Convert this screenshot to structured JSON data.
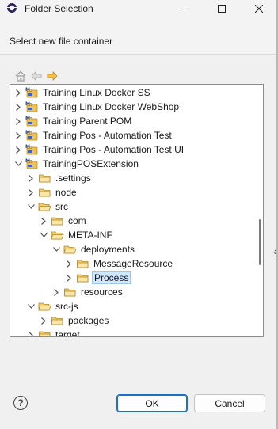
{
  "window": {
    "title": "Folder Selection"
  },
  "dialog": {
    "prompt": "Select new file container"
  },
  "nav": {
    "home_icon": "home-icon",
    "back_icon": "back-arrow-icon",
    "forward_icon": "forward-arrow-icon"
  },
  "tree": {
    "items": [
      {
        "label": "Training Linux Docker SS",
        "depth": 0,
        "expanded": false,
        "kind": "project"
      },
      {
        "label": "Training Linux Docker WebShop",
        "depth": 0,
        "expanded": false,
        "kind": "project"
      },
      {
        "label": "Training Parent POM",
        "depth": 0,
        "expanded": false,
        "kind": "project"
      },
      {
        "label": "Training Pos - Automation Test",
        "depth": 0,
        "expanded": false,
        "kind": "project"
      },
      {
        "label": "Training Pos - Automation Test UI",
        "depth": 0,
        "expanded": false,
        "kind": "project"
      },
      {
        "label": "TrainingPOSExtension",
        "depth": 0,
        "expanded": true,
        "kind": "project"
      },
      {
        "label": ".settings",
        "depth": 1,
        "expanded": false,
        "kind": "folder"
      },
      {
        "label": "node",
        "depth": 1,
        "expanded": false,
        "kind": "folder"
      },
      {
        "label": "src",
        "depth": 1,
        "expanded": true,
        "kind": "folder"
      },
      {
        "label": "com",
        "depth": 2,
        "expanded": false,
        "kind": "folder"
      },
      {
        "label": "META-INF",
        "depth": 2,
        "expanded": true,
        "kind": "folder"
      },
      {
        "label": "deployments",
        "depth": 3,
        "expanded": true,
        "kind": "folder"
      },
      {
        "label": "MessageResource",
        "depth": 4,
        "expanded": false,
        "kind": "folder"
      },
      {
        "label": "Process",
        "depth": 4,
        "expanded": false,
        "kind": "folder",
        "selected": true
      },
      {
        "label": "resources",
        "depth": 3,
        "expanded": false,
        "kind": "folder"
      },
      {
        "label": "src-js",
        "depth": 1,
        "expanded": true,
        "kind": "folder"
      },
      {
        "label": "packages",
        "depth": 2,
        "expanded": false,
        "kind": "folder"
      },
      {
        "label": "target",
        "depth": 1,
        "expanded": false,
        "kind": "folder"
      }
    ]
  },
  "buttons": {
    "help_icon": "help-icon",
    "ok": "OK",
    "cancel": "Cancel"
  },
  "colors": {
    "selection": "#cde8ff",
    "selection_border": "#99c9ef",
    "folder": "#e8b84a",
    "primary_border": "#1e6fc7"
  }
}
